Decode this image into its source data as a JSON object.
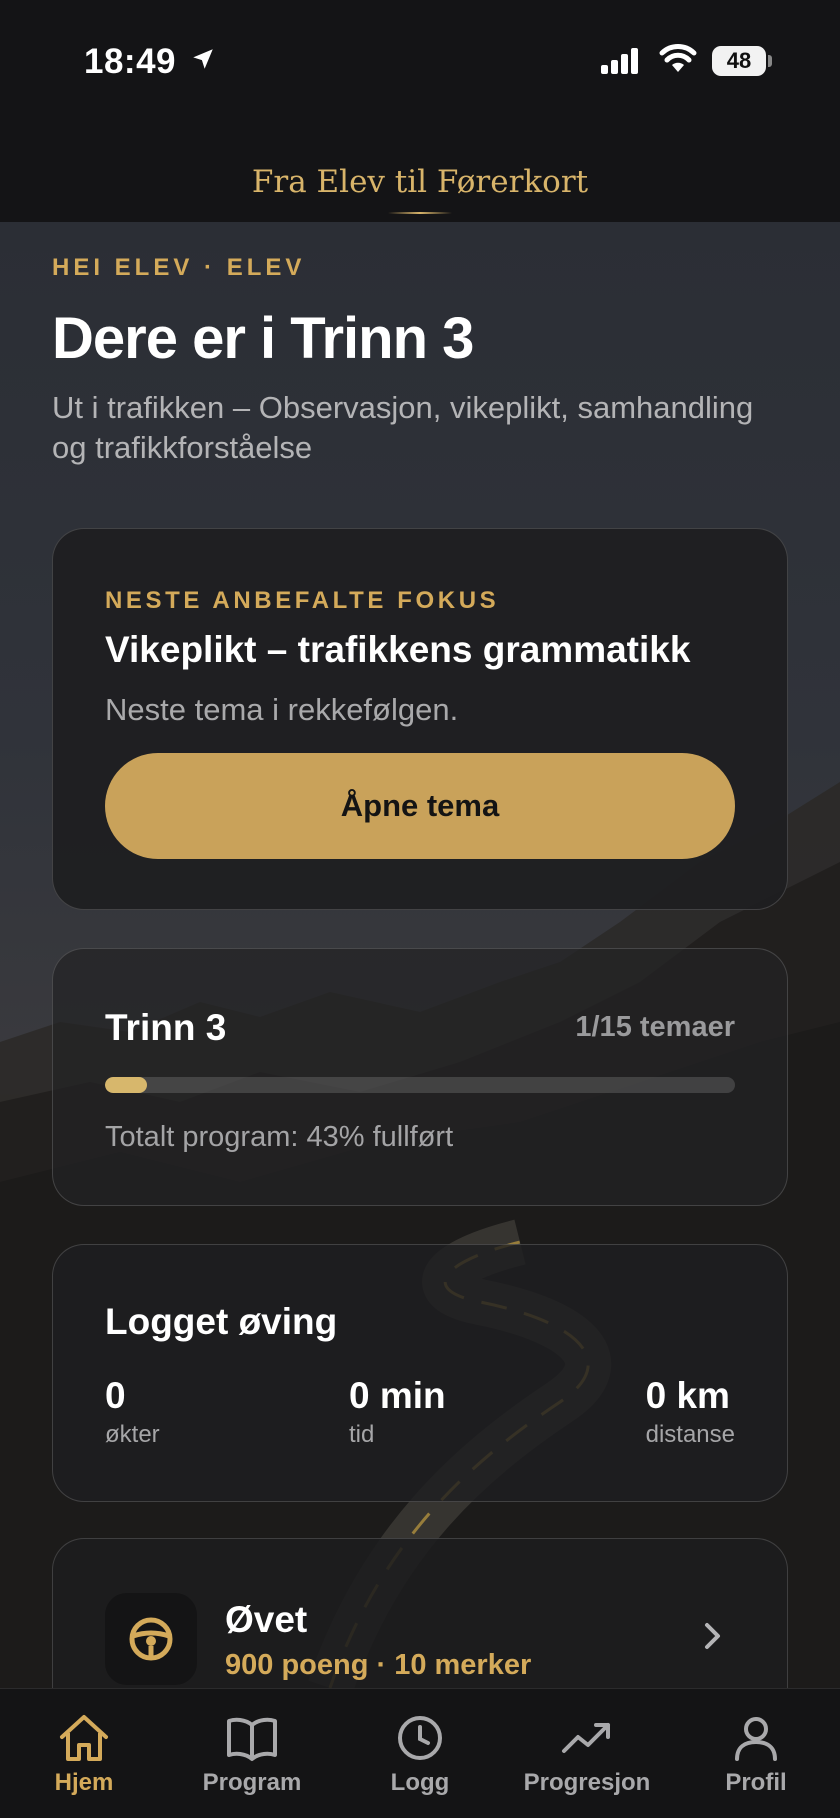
{
  "status_bar": {
    "time": "18:49",
    "battery": "48",
    "icons": [
      "location-arrow-icon",
      "cellular-signal-icon",
      "wifi-icon",
      "battery-icon"
    ]
  },
  "header": {
    "brand": "Fra Elev til Førerkort"
  },
  "hero": {
    "greeting": "HEI ELEV · ELEV",
    "title": "Dere er i Trinn 3",
    "subtitle": "Ut i trafikken – Observasjon, vikeplikt, samhandling og trafikkforståelse"
  },
  "focus_card": {
    "eyebrow": "NESTE ANBEFALTE FOKUS",
    "title": "Vikeplikt – trafikkens grammatikk",
    "description": "Neste tema i rekkefølgen.",
    "button_label": "Åpne tema"
  },
  "progress_card": {
    "title": "Trinn 3",
    "count": "1/15 temaer",
    "progress_fraction": 0.0667,
    "total": "Totalt program: 43% fullført"
  },
  "practice_card": {
    "title": "Logget øving",
    "stats": [
      {
        "value": "0",
        "label": "økter"
      },
      {
        "value": "0 min",
        "label": "tid"
      },
      {
        "value": "0 km",
        "label": "distanse"
      }
    ]
  },
  "level_card": {
    "icon": "steering-wheel-icon",
    "title": "Øvet",
    "subtitle": "900 poeng · 10 merker"
  },
  "tab_bar": {
    "items": [
      {
        "label": "Hjem",
        "icon": "home-icon",
        "active": true
      },
      {
        "label": "Program",
        "icon": "book-icon",
        "active": false
      },
      {
        "label": "Logg",
        "icon": "clock-icon",
        "active": false
      },
      {
        "label": "Progresjon",
        "icon": "trend-up-icon",
        "active": false
      },
      {
        "label": "Profil",
        "icon": "person-icon",
        "active": false
      }
    ]
  },
  "colors": {
    "accent": "#d4aa5a",
    "button": "#c9a25a",
    "background": "#141416"
  }
}
